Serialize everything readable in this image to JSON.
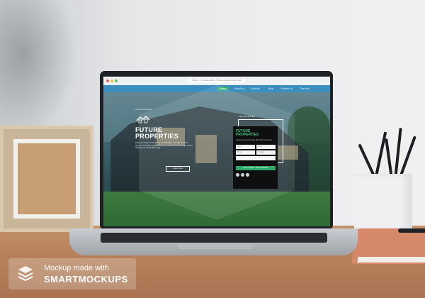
{
  "browser": {
    "url": "https://realestate-futureproperties.com"
  },
  "website": {
    "nav": [
      {
        "label": "Home"
      },
      {
        "label": "About us"
      },
      {
        "label": "Portfolio"
      },
      {
        "label": "Blog"
      },
      {
        "label": "Contact us"
      },
      {
        "label": "Services"
      }
    ],
    "hero": {
      "small_label": "Future Properties",
      "title_line1": "FUTURE",
      "title_line2": "PROPERTIES",
      "text": "Find your dream home with Future Properties. We offer the finest selection of modern residences, luxury villas and contemporary homes designed for comfortable living.",
      "button": "Learn more"
    },
    "form": {
      "top_label": "Ask for full Price",
      "title_line1": "FUTURE",
      "title_line2": "PROPERTIES",
      "subtitle": "Contact us to get the best offer from our experts.",
      "name_placeholder": "Name",
      "email_placeholder": "Email",
      "phone_placeholder": "Phone",
      "message_placeholder": "Message",
      "submit": "Send request / Request details"
    }
  },
  "watermark": {
    "line1": "Mockup made with",
    "line2": "SMARTMOCKUPS"
  },
  "colors": {
    "nav": "#3a8fbf",
    "accent_green": "#3bb07a",
    "form_bg": "#0d0f10"
  }
}
